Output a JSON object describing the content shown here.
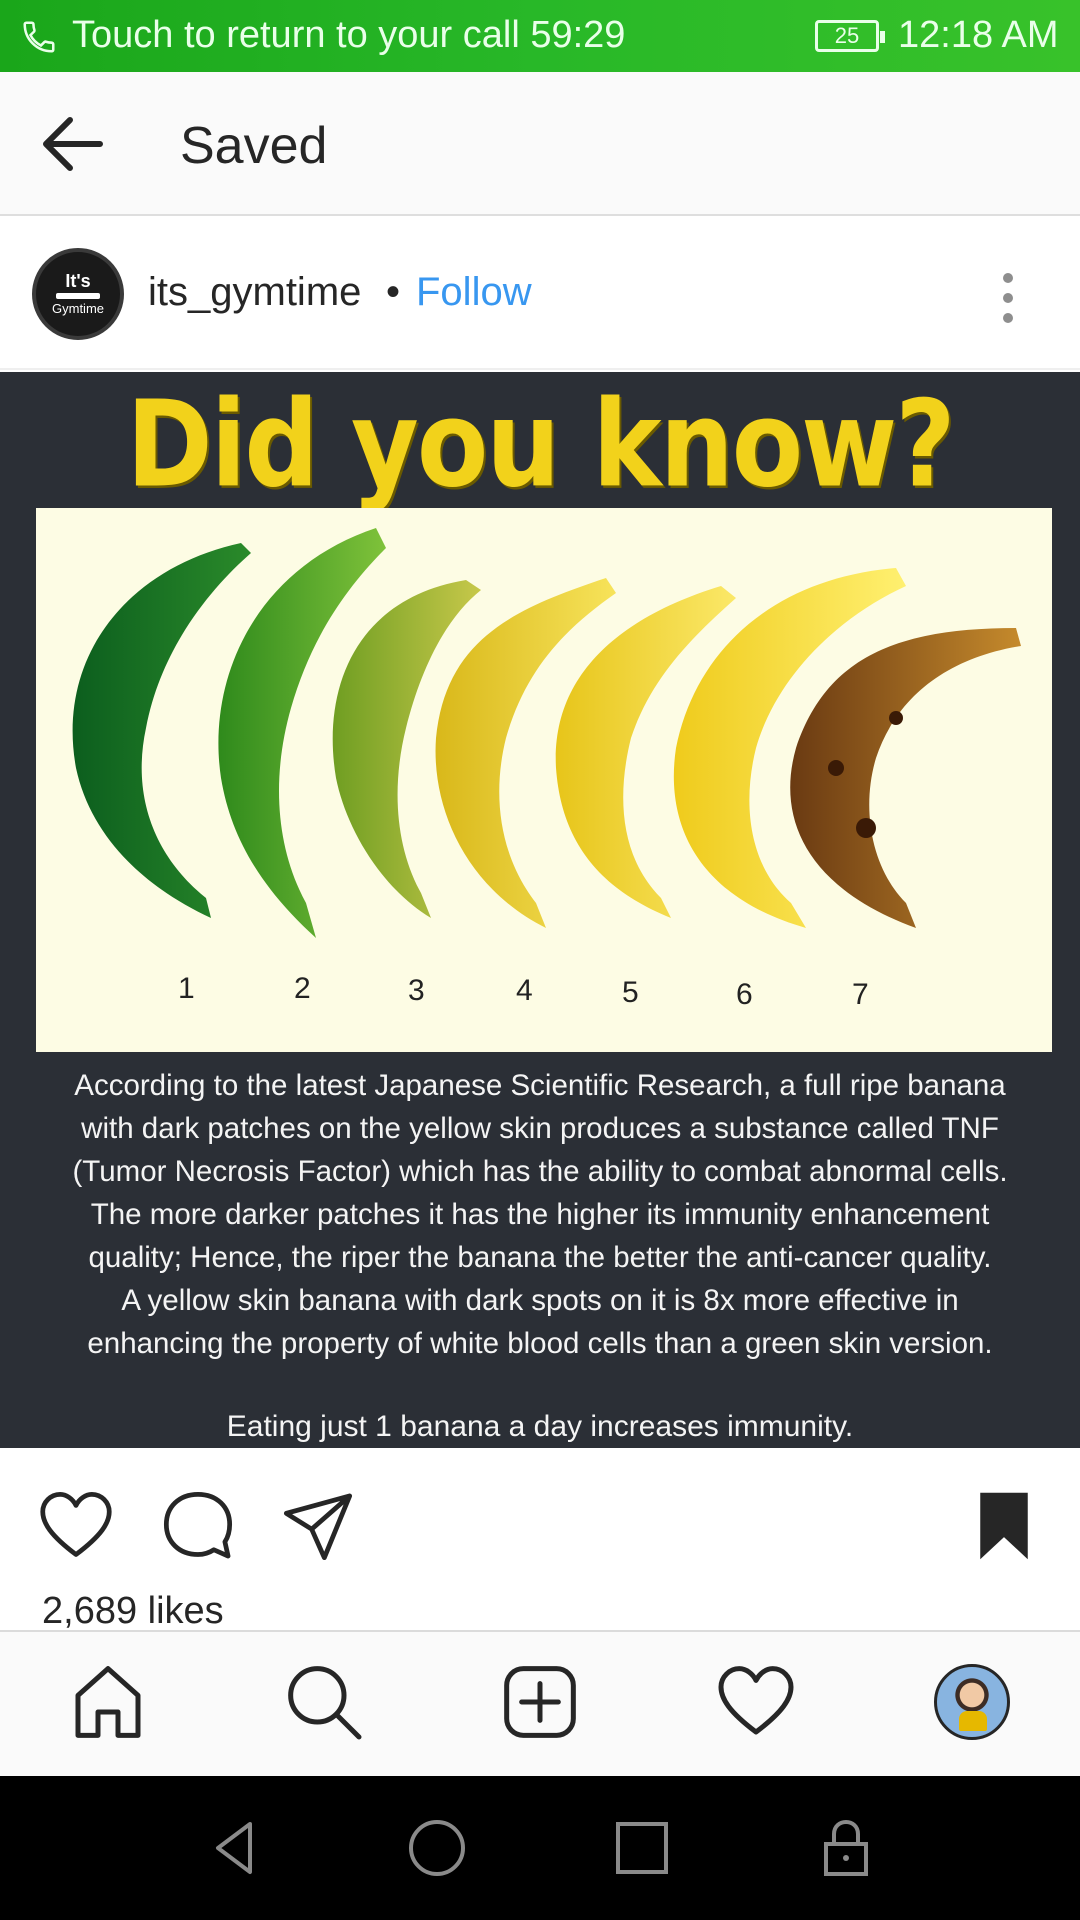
{
  "status_bar": {
    "call_text": "Touch to return to your call 59:29",
    "battery": "25",
    "time": "12:18 AM",
    "bar_color": "#2ab52a"
  },
  "header": {
    "title": "Saved",
    "back_icon": "arrow-left-icon"
  },
  "post": {
    "username": "its_gymtime",
    "separator": "•",
    "follow_label": "Follow",
    "follow_color": "#3897f0",
    "avatar": {
      "top_text": "It's",
      "bottom_text": "Gymtime"
    },
    "image": {
      "headline": "Did you know?",
      "banana_numbers": [
        "1",
        "2",
        "3",
        "4",
        "5",
        "6",
        "7"
      ],
      "caption_lines": [
        "According to the latest Japanese Scientific Research, a full ripe banana",
        "with dark patches on the yellow skin produces a substance called TNF",
        "(Tumor Necrosis Factor) which has the ability to combat abnormal cells.",
        "The more darker patches it has the higher its immunity enhancement",
        "quality; Hence, the riper the banana the better the anti-cancer quality.",
        "A yellow skin banana with dark spots on it is 8x more effective in",
        "enhancing the property of white blood cells than a green skin version."
      ],
      "caption_last": "Eating just 1 banana a day increases immunity."
    },
    "likes": "2,689 likes"
  },
  "actions": {
    "icons": [
      "heart-icon",
      "comment-icon",
      "share-icon",
      "bookmark-icon"
    ]
  },
  "bottom_nav": {
    "icons": [
      "home-icon",
      "search-icon",
      "add-post-icon",
      "activity-heart-icon",
      "profile-avatar"
    ]
  },
  "system_nav": {
    "icons": [
      "back-triangle-icon",
      "home-circle-icon",
      "recents-square-icon",
      "lock-icon"
    ]
  }
}
